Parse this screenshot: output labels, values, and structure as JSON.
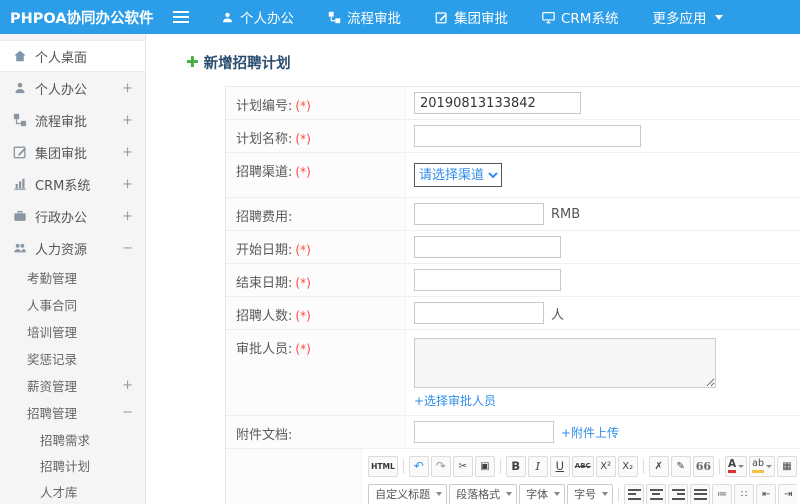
{
  "app": {
    "title": "PHPOA协同办公软件"
  },
  "topnav": {
    "items": [
      {
        "label": "个人办公"
      },
      {
        "label": "流程审批"
      },
      {
        "label": "集团审批"
      },
      {
        "label": "CRM系统"
      },
      {
        "label": "更多应用"
      }
    ]
  },
  "sidebar": {
    "items": [
      {
        "label": "个人桌面",
        "expand": ""
      },
      {
        "label": "个人办公",
        "expand": "+"
      },
      {
        "label": "流程审批",
        "expand": "+"
      },
      {
        "label": "集团审批",
        "expand": "+"
      },
      {
        "label": "CRM系统",
        "expand": "+"
      },
      {
        "label": "行政办公",
        "expand": "+"
      },
      {
        "label": "人力资源",
        "expand": "−"
      },
      {
        "label": "考勤管理",
        "expand": ""
      },
      {
        "label": "人事合同",
        "expand": ""
      },
      {
        "label": "培训管理",
        "expand": ""
      },
      {
        "label": "奖惩记录",
        "expand": ""
      },
      {
        "label": "薪资管理",
        "expand": "+"
      },
      {
        "label": "招聘管理",
        "expand": "−"
      },
      {
        "label": "招聘需求",
        "expand": ""
      },
      {
        "label": "招聘计划",
        "expand": ""
      },
      {
        "label": "人才库",
        "expand": ""
      }
    ]
  },
  "page": {
    "title": "新增招聘计划",
    "title_icon": "✚"
  },
  "form": {
    "plan_no": {
      "label": "计划编号:",
      "req": "(*)",
      "value": "20190813133842"
    },
    "plan_name": {
      "label": "计划名称:",
      "req": "(*)",
      "value": ""
    },
    "channel": {
      "label": "招聘渠道:",
      "req": "(*)",
      "selected": "请选择渠道"
    },
    "fee": {
      "label": "招聘费用:",
      "req": "",
      "value": "",
      "suffix": "RMB"
    },
    "start_date": {
      "label": "开始日期:",
      "req": "(*)",
      "value": ""
    },
    "end_date": {
      "label": "结束日期:",
      "req": "(*)",
      "value": ""
    },
    "headcount": {
      "label": "招聘人数:",
      "req": "(*)",
      "value": "",
      "suffix": "人"
    },
    "approver": {
      "label": "审批人员:",
      "req": "(*)",
      "link": "+选择审批人员"
    },
    "attachment": {
      "label": "附件文档:",
      "req": "",
      "value": "",
      "link": "+附件上传"
    }
  },
  "editor": {
    "row1": [
      {
        "name": "source-code-button",
        "glyph": "HTML"
      },
      {
        "name": "undo-button",
        "glyph": "↶"
      },
      {
        "name": "redo-button",
        "glyph": "↷"
      },
      {
        "name": "cut-button",
        "glyph": "✂"
      },
      {
        "name": "paste-button",
        "glyph": "▣"
      },
      {
        "name": "bold-button",
        "glyph": "B"
      },
      {
        "name": "italic-button",
        "glyph": "I"
      },
      {
        "name": "underline-button",
        "glyph": "U"
      },
      {
        "name": "strikethrough-button",
        "glyph": "ABC"
      },
      {
        "name": "superscript-button",
        "glyph": "X²"
      },
      {
        "name": "subscript-button",
        "glyph": "X₂"
      },
      {
        "name": "remove-format-button",
        "glyph": "✗"
      },
      {
        "name": "format-brush-button",
        "glyph": "✎"
      },
      {
        "name": "blockquote-button",
        "glyph": "66"
      },
      {
        "name": "font-color-button",
        "glyph": "A"
      },
      {
        "name": "highlight-color-button",
        "glyph": "ab"
      },
      {
        "name": "insert-table-button",
        "glyph": "▦"
      }
    ],
    "row2_selects": [
      {
        "name": "heading-select",
        "label": "自定义标题"
      },
      {
        "name": "paragraph-format-select",
        "label": "段落格式"
      },
      {
        "name": "font-family-select",
        "label": "字体"
      },
      {
        "name": "font-size-select",
        "label": "字号"
      }
    ],
    "row2_buttons": [
      {
        "name": "align-left-button"
      },
      {
        "name": "align-center-button"
      },
      {
        "name": "align-right-button"
      },
      {
        "name": "align-justify-button"
      },
      {
        "name": "ordered-list-button",
        "glyph": "≔"
      },
      {
        "name": "unordered-list-button",
        "glyph": "∷"
      },
      {
        "name": "outdent-button",
        "glyph": "⇤"
      },
      {
        "name": "indent-button",
        "glyph": "⇥"
      }
    ]
  },
  "colors": {
    "topbar": "#2c9de8",
    "link": "#2f8ded",
    "required_mark": "#fa4b41",
    "page_title": "#2a4c70",
    "plus_icon": "#44ad3f"
  }
}
